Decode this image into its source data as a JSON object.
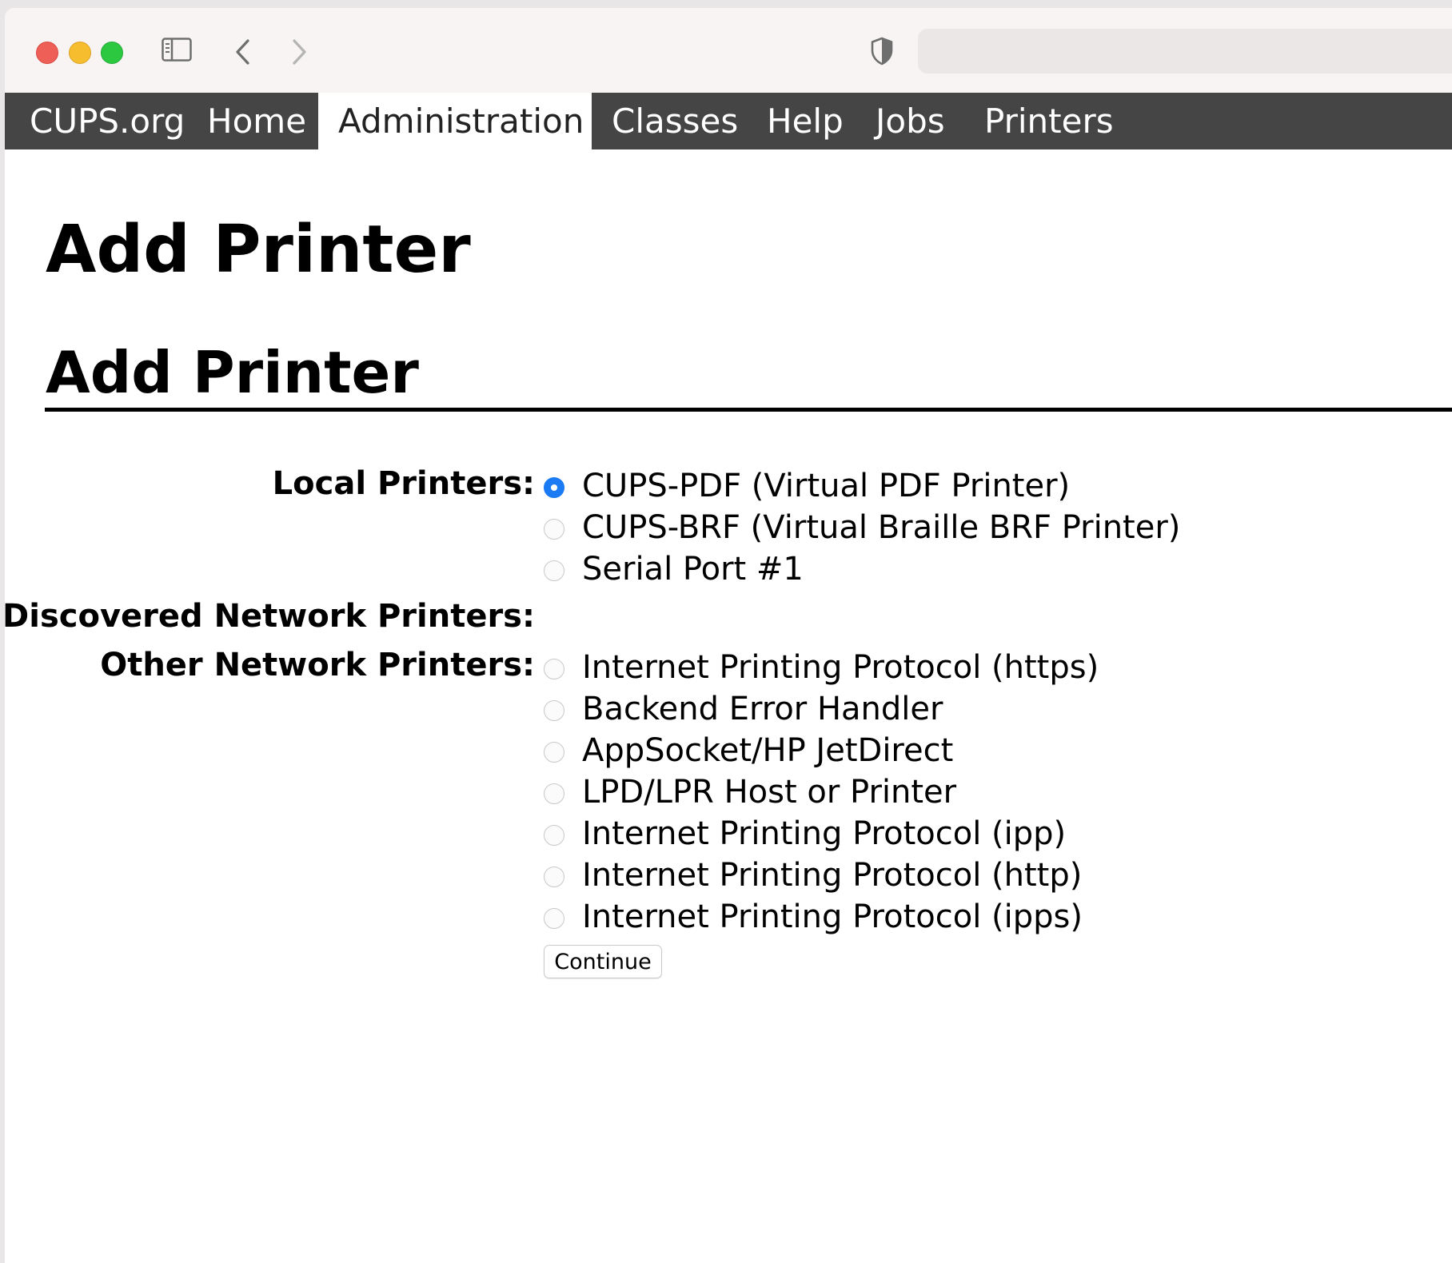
{
  "browser": {
    "icons": [
      "close-button",
      "minimize-button",
      "maximize-button",
      "sidebar-icon",
      "back-arrow-icon",
      "forward-arrow-icon",
      "shield-icon"
    ],
    "url": ""
  },
  "menu": {
    "items": [
      {
        "label": "CUPS.org",
        "active": false
      },
      {
        "label": "Home",
        "active": false
      },
      {
        "label": "Administration",
        "active": true
      },
      {
        "label": "Classes",
        "active": false
      },
      {
        "label": "Help",
        "active": false
      },
      {
        "label": "Jobs",
        "active": false
      },
      {
        "label": "Printers",
        "active": false
      }
    ]
  },
  "page": {
    "title": "Add Printer",
    "section_title": "Add Printer"
  },
  "form": {
    "local_label": "Local Printers:",
    "discovered_label": "Discovered Network Printers:",
    "other_label": "Other Network Printers:",
    "local_options": [
      {
        "label": "CUPS-PDF (Virtual PDF Printer)",
        "checked": true
      },
      {
        "label": "CUPS-BRF (Virtual Braille BRF Printer)",
        "checked": false
      },
      {
        "label": "Serial Port #1",
        "checked": false
      }
    ],
    "other_options": [
      {
        "label": "Internet Printing Protocol (https)",
        "checked": false
      },
      {
        "label": "Backend Error Handler",
        "checked": false
      },
      {
        "label": "AppSocket/HP JetDirect",
        "checked": false
      },
      {
        "label": "LPD/LPR Host or Printer",
        "checked": false
      },
      {
        "label": "Internet Printing Protocol (ipp)",
        "checked": false
      },
      {
        "label": "Internet Printing Protocol (http)",
        "checked": false
      },
      {
        "label": "Internet Printing Protocol (ipps)",
        "checked": false
      }
    ],
    "continue_label": "Continue"
  },
  "colors": {
    "menubar": "#454545",
    "radio_checked": "#1a7bf5",
    "close": "#ed5f57",
    "minimize": "#f6be2f",
    "maximize": "#2bc840"
  }
}
